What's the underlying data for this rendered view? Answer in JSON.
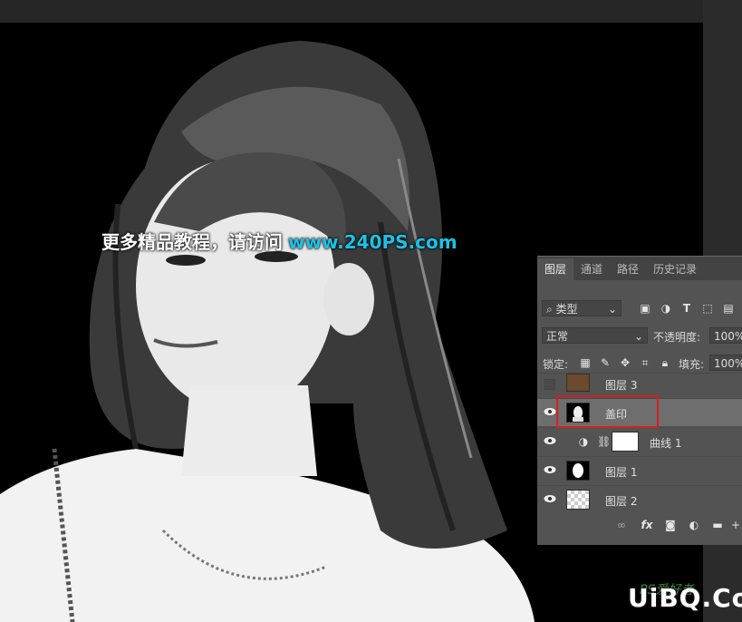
{
  "watermark": {
    "cn": "更多精品教程，请访问",
    "url": "www.240PS.com"
  },
  "brand": {
    "logo": "UiBQ.CoM",
    "sub": "PS爱好者"
  },
  "layers_panel": {
    "tabs": [
      "图层",
      "通道",
      "路径",
      "历史记录"
    ],
    "filter_kind": "类型",
    "blend_mode": "正常",
    "opacity_label": "不透明度:",
    "opacity_value": "100%",
    "lock_label": "锁定:",
    "fill_label": "填充:",
    "fill_value": "100%",
    "layers": [
      {
        "name": "图层 3",
        "visible": false,
        "thumb_color": "#6b4a2e"
      },
      {
        "name": "盖印",
        "visible": true,
        "selected": true
      },
      {
        "name": "曲线 1",
        "visible": true,
        "adjustment": true
      },
      {
        "name": "图层 1",
        "visible": true
      },
      {
        "name": "图层 2",
        "visible": true
      }
    ]
  },
  "colors": {
    "accent_red": "#d61f1f",
    "url_cyan": "#19c3e8",
    "panel_bg": "#535353"
  }
}
